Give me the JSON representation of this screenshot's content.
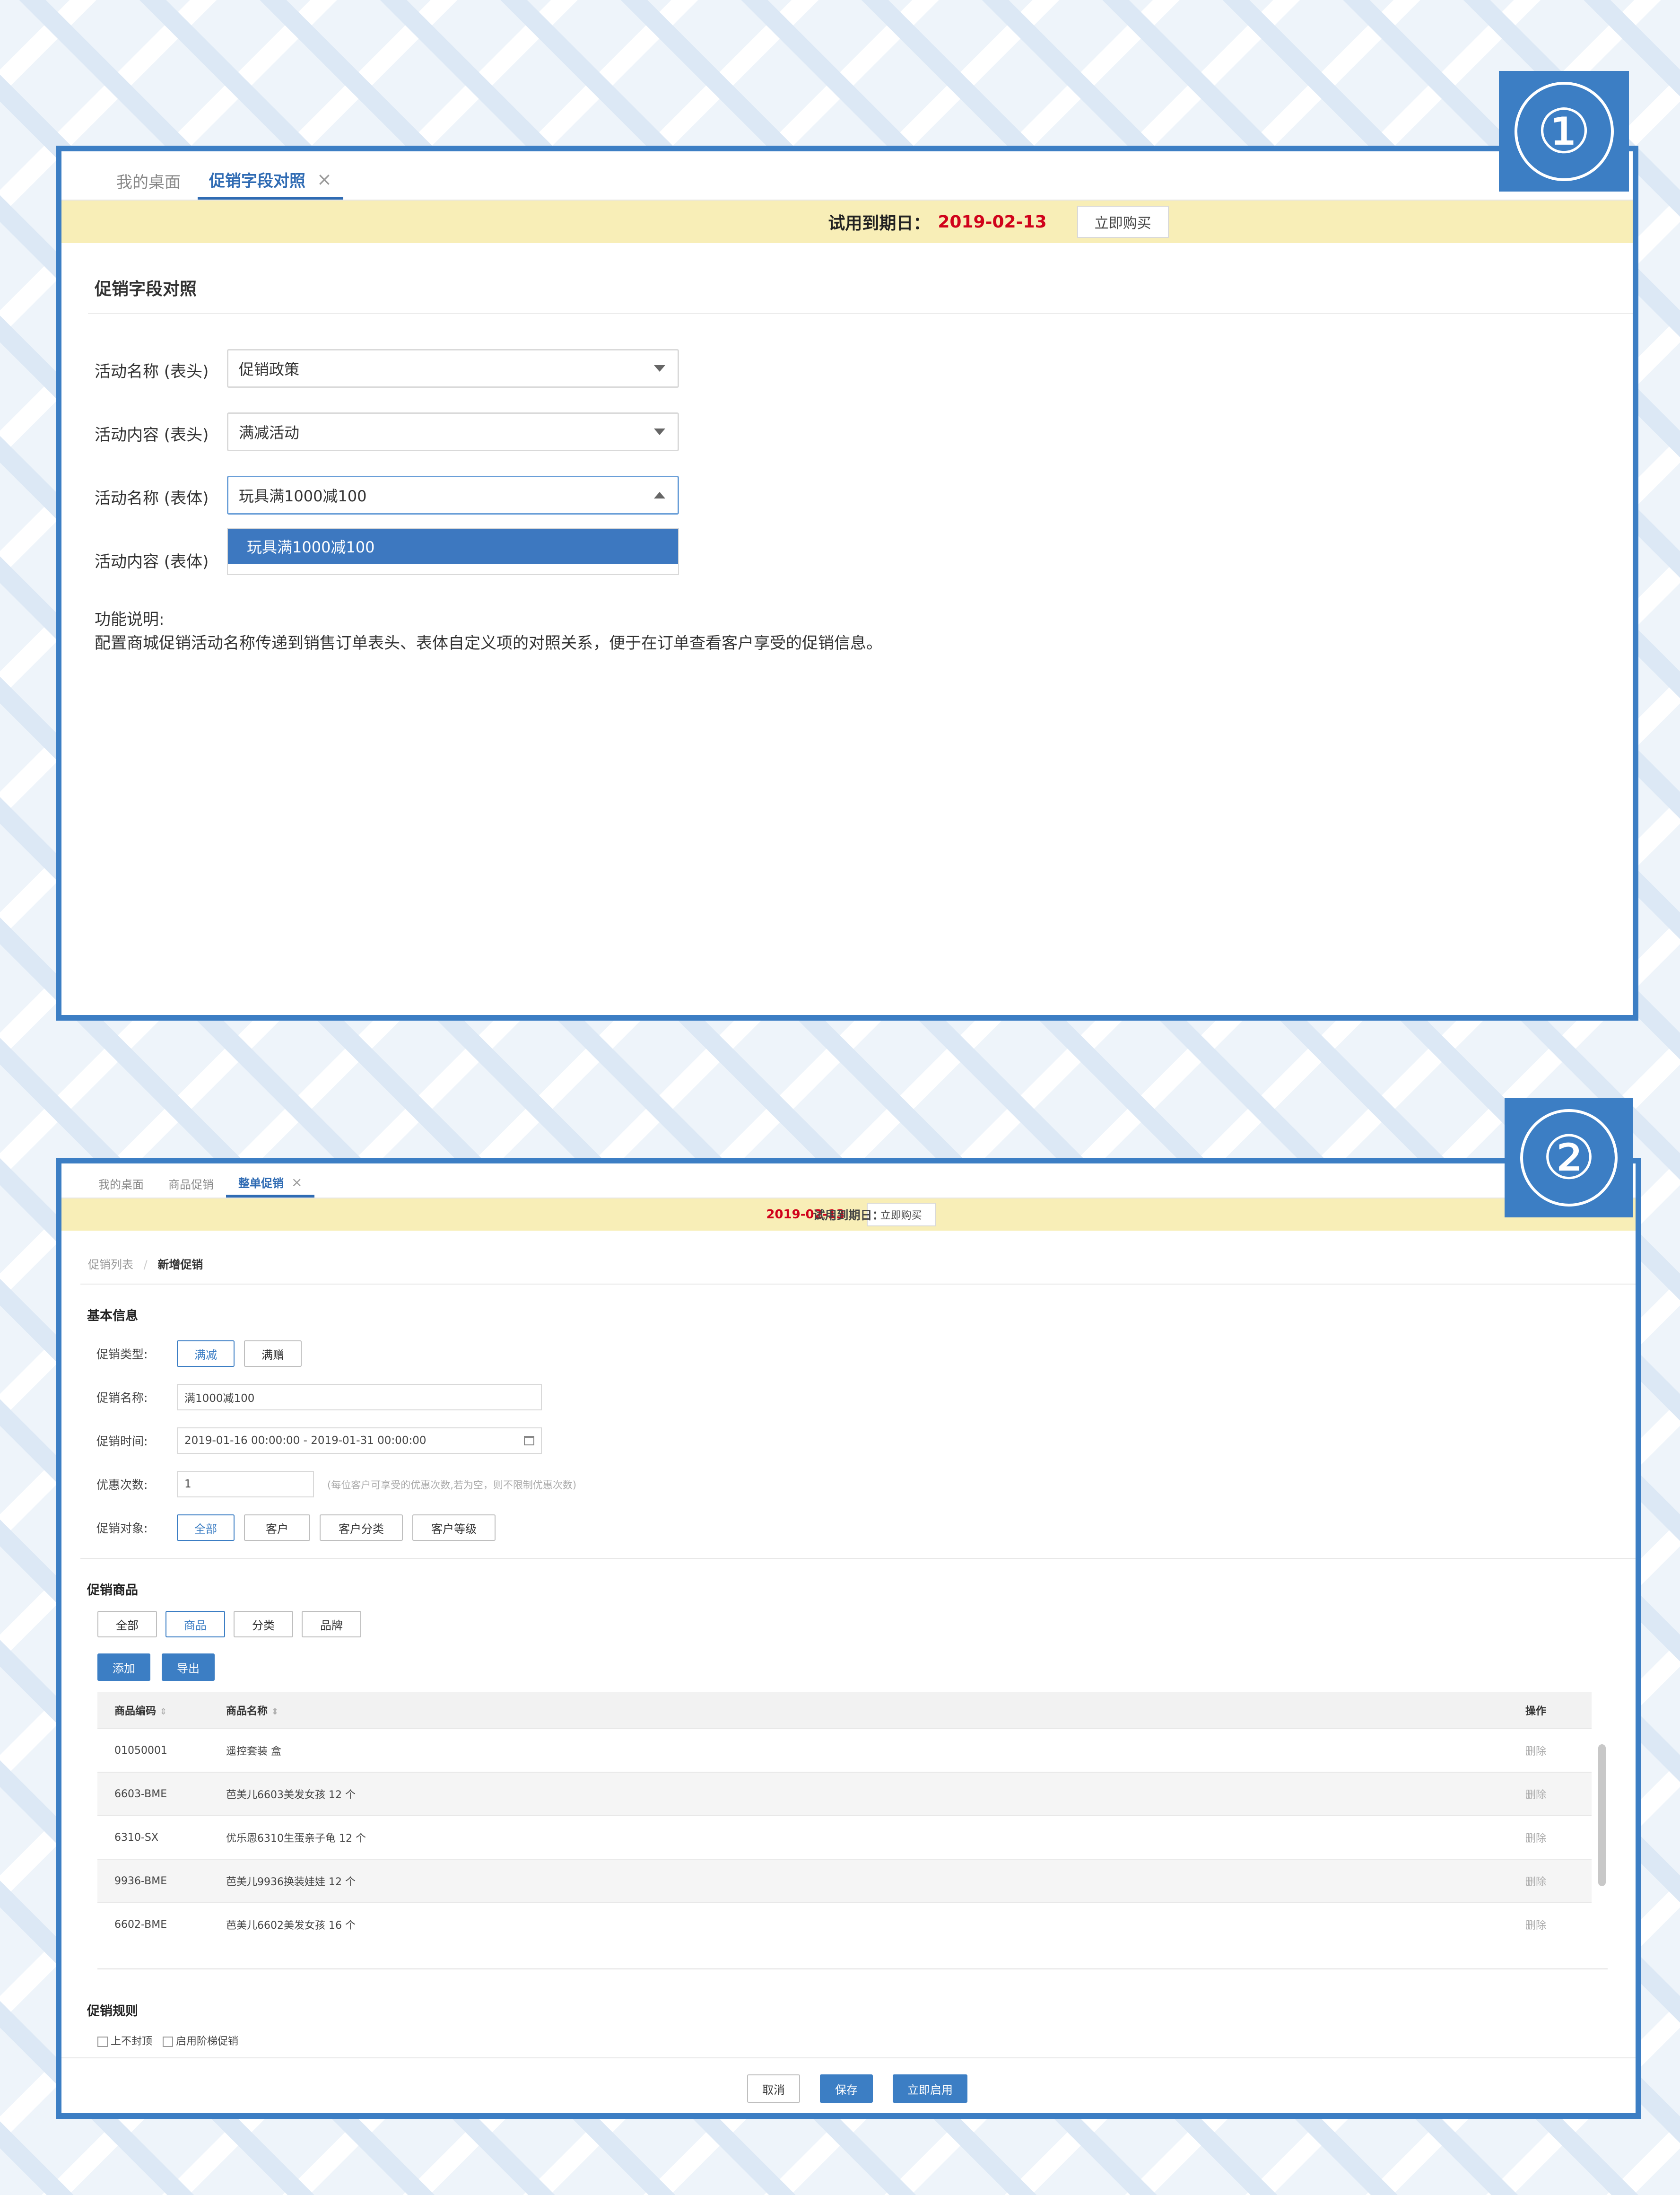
{
  "panel1": {
    "badge": "①",
    "tabs": [
      {
        "label": "我的桌面"
      },
      {
        "label": "促销字段对照",
        "close": "×"
      }
    ],
    "trial": {
      "label": "试用到期日：",
      "date": "2019-02-13",
      "buy_button": "立即购买"
    },
    "page_title": "促销字段对照",
    "fields": [
      {
        "label": "活动名称 (表头)",
        "value": "促销政策"
      },
      {
        "label": "活动内容 (表头)",
        "value": "满减活动"
      },
      {
        "label": "活动名称 (表体)",
        "value": "玩具满1000减100"
      },
      {
        "label": "活动内容 (表体)",
        "value": ""
      }
    ],
    "dropdown_option": "玩具满1000减100",
    "help_title": "功能说明:",
    "help_text": "配置商城促销活动名称传递到销售订单表头、表体自定义项的对照关系，便于在订单查看客户享受的促销信息。"
  },
  "panel2": {
    "badge": "②",
    "tabs": [
      {
        "label": "我的桌面"
      },
      {
        "label": "商品促销"
      },
      {
        "label": "整单促销",
        "close": "×"
      }
    ],
    "trial": {
      "label": "试用到期日：",
      "date": "2019-02-13",
      "buy_button": "立即购买"
    },
    "breadcrumb": {
      "parent": "促销列表",
      "sep": "/",
      "current": "新增促销"
    },
    "basic_title": "基本信息",
    "type_label": "促销类型:",
    "type_options": [
      "满减",
      "满赠"
    ],
    "name_label": "促销名称:",
    "name_value": "满1000减100",
    "time_label": "促销时间:",
    "time_value": "2019-01-16 00:00:00 - 2019-01-31 00:00:00",
    "count_label": "优惠次数:",
    "count_value": "1",
    "count_hint": "(每位客户可享受的优惠次数,若为空，则不限制优惠次数)",
    "target_label": "促销对象:",
    "target_options": [
      "全部",
      "客户",
      "客户分类",
      "客户等级"
    ],
    "goods_title": "促销商品",
    "goods_filters": [
      "全部",
      "商品",
      "分类",
      "品牌"
    ],
    "add_button": "添加",
    "export_button": "导出",
    "table": {
      "headers": [
        "商品编码",
        "商品名称",
        "操作"
      ],
      "rows": [
        {
          "code": "01050001",
          "name": "遥控套装 盒",
          "op": "删除"
        },
        {
          "code": "6603-BME",
          "name": "芭美儿6603美发女孩 12 个",
          "op": "删除"
        },
        {
          "code": "6310-SX",
          "name": "优乐恩6310生蛋亲子龟 12 个",
          "op": "删除"
        },
        {
          "code": "9936-BME",
          "name": "芭美儿9936换装娃娃 12 个",
          "op": "删除"
        },
        {
          "code": "6602-BME",
          "name": "芭美儿6602美发女孩 16 个",
          "op": "删除"
        }
      ]
    },
    "rules_title": "促销规则",
    "rule_options": [
      "上不封顶",
      "启用阶梯促销"
    ],
    "footer_buttons": [
      "取消",
      "保存",
      "立即启用"
    ]
  },
  "colors": {
    "accent": "#3c7ec4",
    "trial_bg": "#f8eeb7",
    "date_red": "#d0021b"
  }
}
